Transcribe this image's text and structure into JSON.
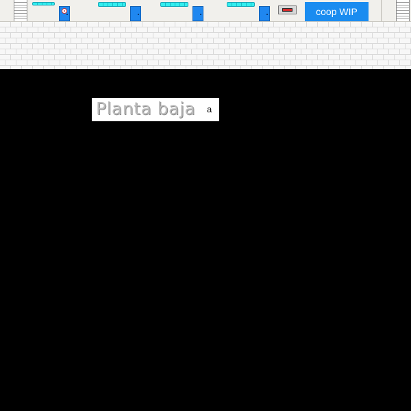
{
  "hud": {
    "wip_button_label": "coop WIP"
  },
  "floor_label": {
    "title": "Planta baja",
    "key_hint": "a"
  },
  "icons": {
    "stairs": "stairs-icon",
    "lamp": "ceiling-lamp-icon",
    "door": "door-icon",
    "exit_sign": "fire-alarm-icon"
  },
  "colors": {
    "background": "#000000",
    "floor": "#f1f0ec",
    "lamp": "#33eeee",
    "door": "#1f87f0",
    "button": "#1a8cf0",
    "brick_wall": "#f7f7f7"
  }
}
